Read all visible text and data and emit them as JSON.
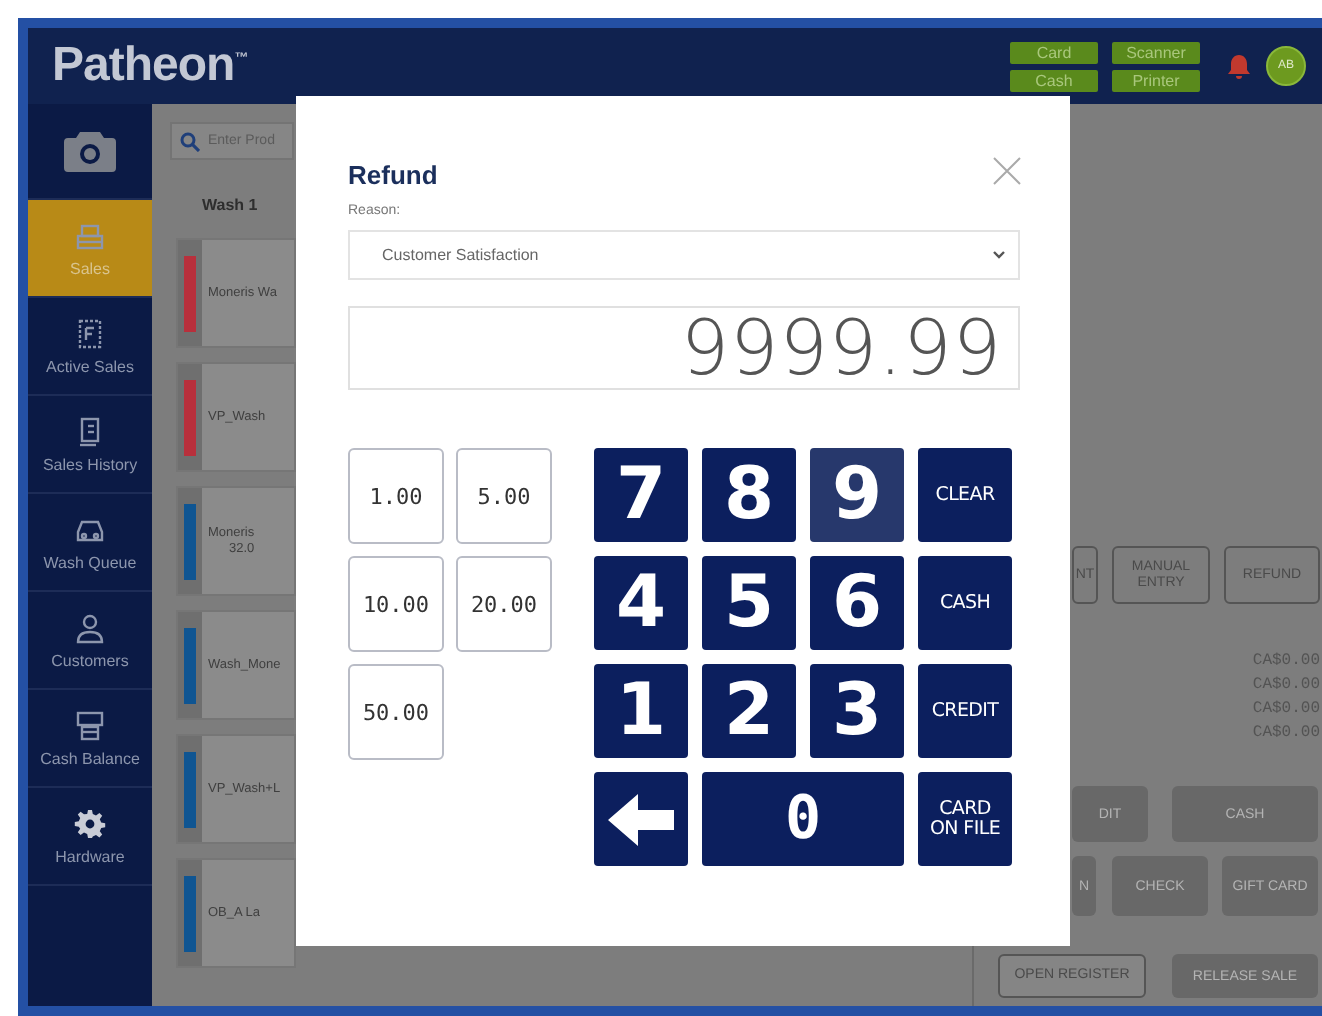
{
  "header": {
    "logo": "Patheon$^{™}$",
    "status_buttons": [
      {
        "label": "Card"
      },
      {
        "label": "Scanner"
      },
      {
        "label": "Cash"
      },
      {
        "label": "Printer"
      }
    ],
    "avatar": "AB"
  },
  "sidebar": {
    "items": [
      {
        "kind": "sales",
        "label": "Sales",
        "selected": true
      },
      {
        "kind": "active",
        "label": "Active Sales",
        "selected": false
      },
      {
        "kind": "history",
        "label": "Sales History",
        "selected": false
      },
      {
        "kind": "queue",
        "label": "Wash Queue",
        "selected": false
      },
      {
        "kind": "customers",
        "label": "Customers",
        "selected": false
      },
      {
        "kind": "cash",
        "label": "Cash Balance",
        "selected": false
      },
      {
        "kind": "hardware",
        "label": "Hardware",
        "selected": false
      }
    ]
  },
  "search": {
    "placeholder": "Enter Prod"
  },
  "product_tab": "Wash 1",
  "products": [
    {
      "name": "Moneris Wa",
      "color": "#b8303c"
    },
    {
      "name": "VP_Wash",
      "color": "#b8303c"
    },
    {
      "name": "Moneris",
      "price": "32.0",
      "color": "#0f5592"
    },
    {
      "name": "Wash_Mone",
      "color": "#0f5592"
    },
    {
      "name": "VP_Wash+L",
      "color": "#0f5592"
    },
    {
      "name": "OB_A La",
      "color": "#0f5592"
    }
  ],
  "right_panel": {
    "actions": [
      "NT",
      "MANUAL ENTRY",
      "REFUND"
    ],
    "totals": [
      "CA$0.00",
      "CA$0.00",
      "CA$0.00",
      "CA$0.00"
    ],
    "payments": [
      [
        "DIT",
        "CASH"
      ],
      [
        "N",
        "CHECK",
        "GIFT CARD"
      ]
    ],
    "open_register": "OPEN REGISTER",
    "release_sale": "RELEASE SALE"
  },
  "modal": {
    "title": "Refund",
    "reason_label": "Reason:",
    "reason": "Customer Satisfaction",
    "amount": "9999.99",
    "quick_amounts": [
      "1.00",
      "5.00",
      "10.00",
      "20.00",
      "50.00"
    ],
    "keys": [
      {
        "kind": "digit",
        "label": "7",
        "pressed": false
      },
      {
        "kind": "digit",
        "label": "8",
        "pressed": false
      },
      {
        "kind": "digit",
        "label": "9",
        "pressed": true
      },
      {
        "kind": "action",
        "label": "CLEAR",
        "pressed": false
      },
      {
        "kind": "digit",
        "label": "4",
        "pressed": false
      },
      {
        "kind": "digit",
        "label": "5",
        "pressed": false
      },
      {
        "kind": "digit",
        "label": "6",
        "pressed": false
      },
      {
        "kind": "action",
        "label": "CASH",
        "pressed": false
      },
      {
        "kind": "digit",
        "label": "1",
        "pressed": false
      },
      {
        "kind": "digit",
        "label": "2",
        "pressed": false
      },
      {
        "kind": "digit",
        "label": "3",
        "pressed": false
      },
      {
        "kind": "action",
        "label": "CREDIT",
        "pressed": false
      },
      {
        "kind": "backspace",
        "pressed": false
      },
      {
        "kind": "wide",
        "label": "0",
        "pressed": false
      },
      {
        "kind": "action",
        "label": "CARD ON FILE",
        "pressed": false
      }
    ]
  }
}
